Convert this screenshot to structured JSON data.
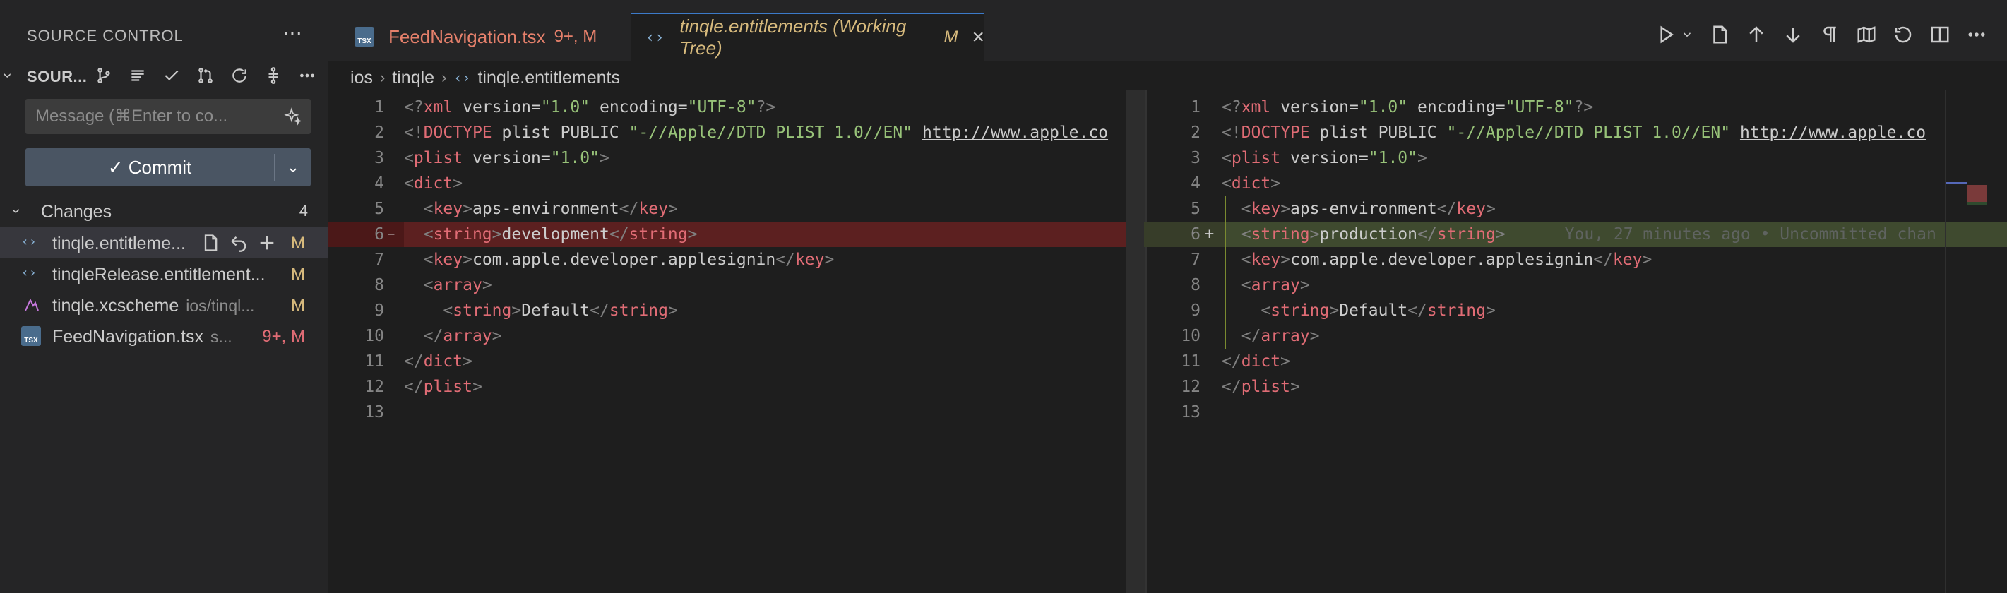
{
  "sidebar": {
    "title": "SOURCE CONTROL",
    "section_label": "SOUR...",
    "message_placeholder": "Message (⌘Enter to co...",
    "commit_label": "✓ Commit",
    "changes_label": "Changes",
    "changes_count": "4",
    "files": [
      {
        "name": "tinqle.entitleme...",
        "path": "",
        "status": "M",
        "icon": "xml-brackets-icon"
      },
      {
        "name": "tinqleRelease.entitlement...",
        "path": "",
        "status": "M",
        "icon": "xml-brackets-icon"
      },
      {
        "name": "tinqle.xcscheme",
        "path": "ios/tinql...",
        "status": "M",
        "icon": "xcscheme-icon"
      },
      {
        "name": "FeedNavigation.tsx",
        "path": "s...",
        "status": "9+, M",
        "icon": "tsx-file-icon"
      }
    ]
  },
  "tabs": [
    {
      "label": "FeedNavigation.tsx",
      "status": "9+, M"
    },
    {
      "label": "tinqle.entitlements (Working Tree)",
      "status": "M"
    }
  ],
  "breadcrumb": [
    "ios",
    "tinqle",
    "tinqle.entitlements"
  ],
  "diff": {
    "left": [
      {
        "n": "1",
        "text": "<?xml version=\"1.0\" encoding=\"UTF-8\"?>"
      },
      {
        "n": "2",
        "text": "<!DOCTYPE plist PUBLIC \"-//Apple//DTD PLIST 1.0//EN\" \"http://www.apple.co"
      },
      {
        "n": "3",
        "text": "<plist version=\"1.0\">"
      },
      {
        "n": "4",
        "text": "<dict>"
      },
      {
        "n": "5",
        "text": "  <key>aps-environment</key>"
      },
      {
        "n": "6",
        "text": "  <string>development</string>"
      },
      {
        "n": "7",
        "text": "  <key>com.apple.developer.applesignin</key>"
      },
      {
        "n": "8",
        "text": "  <array>"
      },
      {
        "n": "9",
        "text": "    <string>Default</string>"
      },
      {
        "n": "10",
        "text": "  </array>"
      },
      {
        "n": "11",
        "text": "</dict>"
      },
      {
        "n": "12",
        "text": "</plist>"
      },
      {
        "n": "13",
        "text": ""
      }
    ],
    "right": [
      {
        "n": "1",
        "text": "<?xml version=\"1.0\" encoding=\"UTF-8\"?>"
      },
      {
        "n": "2",
        "text": "<!DOCTYPE plist PUBLIC \"-//Apple//DTD PLIST 1.0//EN\" \"http://www.apple.co"
      },
      {
        "n": "3",
        "text": "<plist version=\"1.0\">"
      },
      {
        "n": "4",
        "text": "<dict>"
      },
      {
        "n": "5",
        "text": "  <key>aps-environment</key>"
      },
      {
        "n": "6",
        "text": "  <string>production</string>"
      },
      {
        "n": "7",
        "text": "  <key>com.apple.developer.applesignin</key>"
      },
      {
        "n": "8",
        "text": "  <array>"
      },
      {
        "n": "9",
        "text": "    <string>Default</string>"
      },
      {
        "n": "10",
        "text": "  </array>"
      },
      {
        "n": "11",
        "text": "</dict>"
      },
      {
        "n": "12",
        "text": "</plist>"
      },
      {
        "n": "13",
        "text": ""
      }
    ],
    "removed_line": 6,
    "added_line": 6,
    "blame": "You, 27 minutes ago • Uncommitted chan"
  },
  "colors": {
    "accent": "#3c7ac8",
    "modified": "#d7ba7d",
    "tab_error": "#e5806b",
    "removed_bg": "#5c2020",
    "added_bg": "#3f4a2f"
  }
}
